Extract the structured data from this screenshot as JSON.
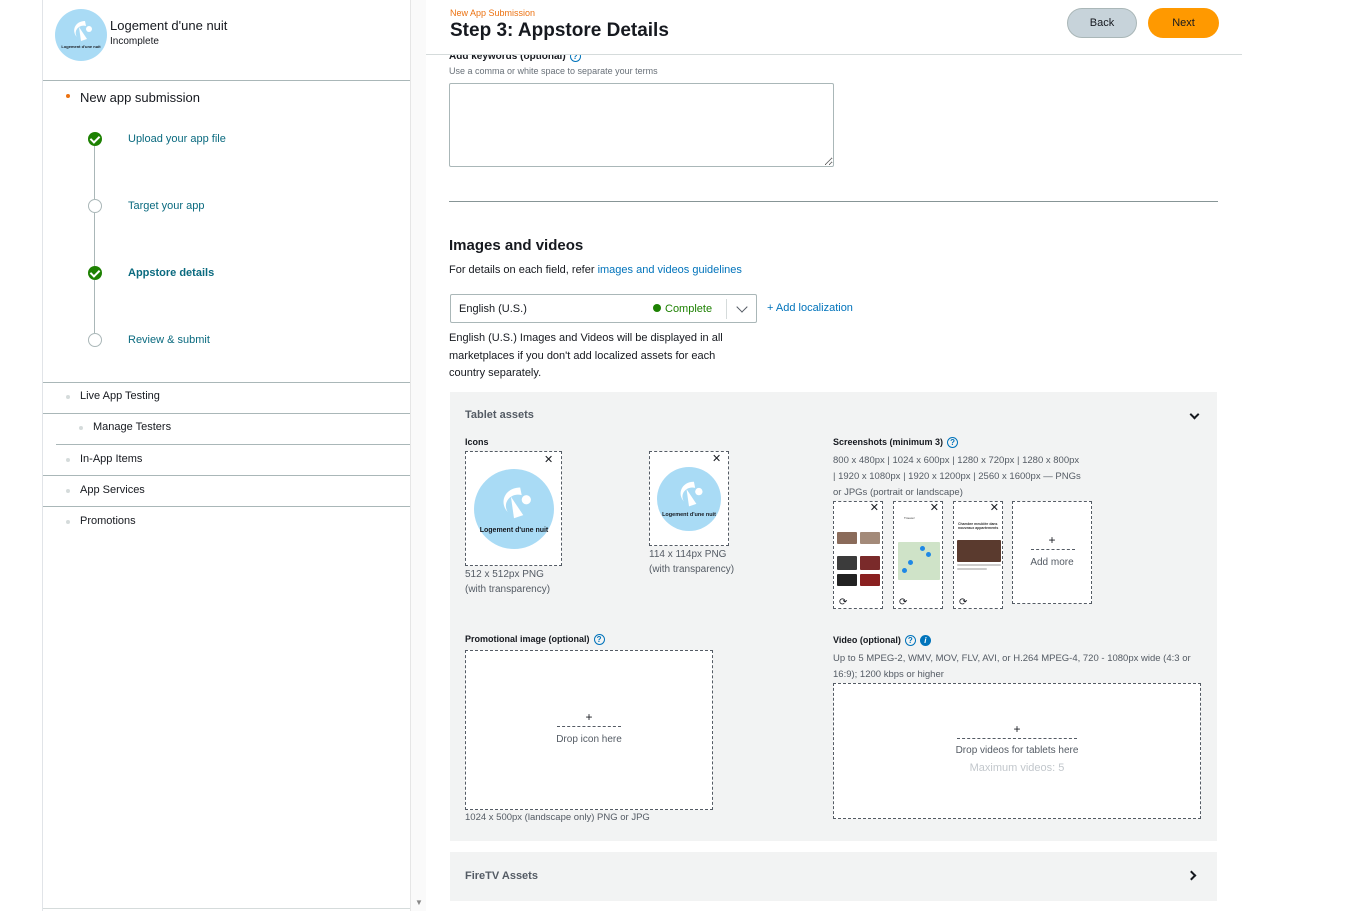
{
  "app": {
    "name": "Logement d'une nuit",
    "status": "Incomplete",
    "logo_text": "Logement d'une nuit"
  },
  "sidebar": {
    "section_title": "New app submission",
    "steps": [
      {
        "label": "Upload your app file",
        "state": "done"
      },
      {
        "label": "Target your app",
        "state": "todo"
      },
      {
        "label": "Appstore details",
        "state": "done",
        "active": true
      },
      {
        "label": "Review & submit",
        "state": "todo"
      }
    ],
    "items": [
      {
        "label": "Live App Testing"
      },
      {
        "label": "Manage Testers"
      },
      {
        "label": "In-App Items"
      },
      {
        "label": "App Services"
      },
      {
        "label": "Promotions"
      }
    ]
  },
  "header": {
    "breadcrumb": "New App Submission",
    "title": "Step 3: Appstore Details",
    "back_label": "Back",
    "next_label": "Next"
  },
  "keywords": {
    "label": "Add keywords (optional)",
    "hint": "Use a comma or white space to separate your terms",
    "value": ""
  },
  "images": {
    "title": "Images and videos",
    "desc_prefix": "For details on each field, refer ",
    "desc_link": "images and videos guidelines",
    "locale": "English (U.S.)",
    "locale_status": "Complete",
    "add_localization": "Add localization",
    "locale_note": "English (U.S.) Images and Videos will be displayed in all marketplaces if you don't add localized assets for each country separately."
  },
  "tablet": {
    "title": "Tablet assets",
    "icons_label": "Icons",
    "icon_large_caption_1": "512 x 512px PNG",
    "icon_large_caption_2": "(with transparency)",
    "icon_small_caption_1": "114 x 114px PNG",
    "icon_small_caption_2": "(with transparency)",
    "screenshots_label": "Screenshots (minimum 3)",
    "screenshots_spec_1": "800 x 480px | 1024 x 600px | 1280 x 720px | 1280 x 800px",
    "screenshots_spec_2": "| 1920 x 1080px | 1920 x 1200px | 2560 x 1600px — PNGs",
    "screenshots_spec_3": "or JPGs (portrait or landscape)",
    "add_more": "Add more",
    "promo_label": "Promotional image (optional)",
    "promo_drop": "Drop icon here",
    "promo_caption": "1024 x 500px (landscape only) PNG or JPG",
    "video_label": "Video (optional)",
    "video_spec_1": "Up to 5 MPEG-2, WMV, MOV, FLV, AVI, or H.264 MPEG-4, 720 - 1080px wide (4:3 or",
    "video_spec_2": "16:9); 1200 kbps or higher",
    "video_drop": "Drop videos for tablets here",
    "video_max": "Maximum videos: 5",
    "screenshot_2_text": "Trouvez",
    "screenshot_3_text": "Chambre meublée dans nouveaux appartements"
  },
  "firetv": {
    "title": "FireTV Assets"
  },
  "colors": {
    "accent": "#ff9900",
    "link": "#0073bb",
    "success": "#1d8102",
    "breadcrumb": "#ec7211"
  }
}
